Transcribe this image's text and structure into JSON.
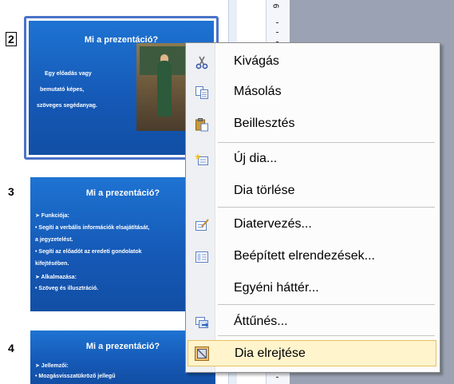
{
  "slides": [
    {
      "number": "2",
      "title": "Mi a prezentáció?",
      "bullets": [
        "Egy előadás vagy",
        "bemutató képes,",
        "szöveges segédanyag."
      ]
    },
    {
      "number": "3",
      "title": "Mi a prezentáció?",
      "bullets": [
        "➤ Funkciója:",
        "  • Segíti a verbális információk elsajátítását,",
        "    a jegyzetelést.",
        "  • Segíti az előadót az eredeti gondolatok",
        "    kifejtésében.",
        "➤ Alkalmazása:",
        "  • Szöveg és illusztráció."
      ]
    },
    {
      "number": "4",
      "title": "Mi a prezentáció?",
      "bullets": [
        "➤ Jellemzői:",
        "  • Mozgásvisszatükröző jellegű"
      ]
    }
  ],
  "ruler": {
    "label": "6"
  },
  "context_menu": {
    "items": [
      {
        "label": "Kivágás",
        "icon": "scissors-icon"
      },
      {
        "label": "Másolás",
        "icon": "copy-icon"
      },
      {
        "label": "Beillesztés",
        "icon": "paste-icon"
      },
      {
        "label": "Új dia...",
        "icon": "new-slide-icon"
      },
      {
        "label": "Dia törlése",
        "icon": ""
      },
      {
        "label": "Diatervezés...",
        "icon": "slide-design-icon"
      },
      {
        "label": "Beépített elrendezések...",
        "icon": "layout-icon"
      },
      {
        "label": "Egyéni háttér...",
        "icon": ""
      },
      {
        "label": "Áttűnés...",
        "icon": "transition-icon"
      },
      {
        "label": "Dia elrejtése",
        "icon": "hide-slide-icon"
      }
    ],
    "highlighted_index": 9
  }
}
